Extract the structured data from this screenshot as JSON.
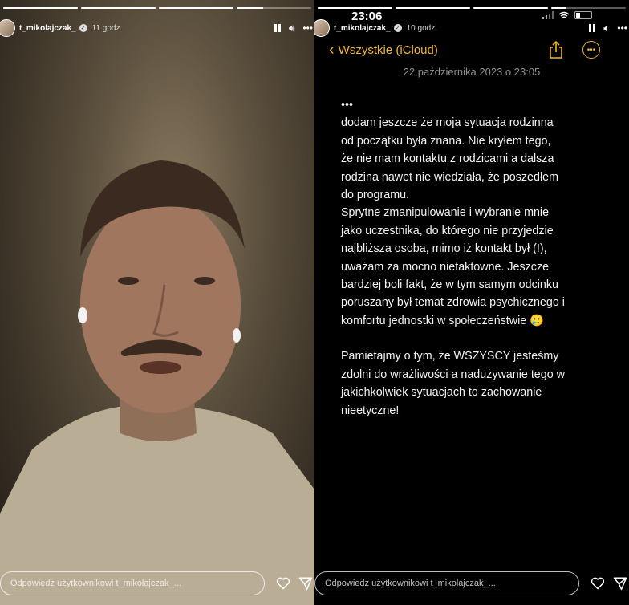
{
  "left_story": {
    "progress": [
      1,
      1,
      1,
      0.35
    ],
    "username": "t_mikolajczak_",
    "time": "11 godz.",
    "reply_placeholder": "Odpowiedz użytkownikowi t_mikolajczak_..."
  },
  "right_story": {
    "progress": [
      1,
      1,
      1,
      0.2
    ],
    "username": "t_mikolajczak_",
    "time": "10 godz.",
    "reply_placeholder": "Odpowiedz użytkownikowi t_mikolajczak_...",
    "ios_time": "23:06",
    "notes": {
      "back_label": "Wszystkie (iCloud)",
      "date": "22 października 2023 o 23:05",
      "ellipsis": "•••",
      "paragraph1": [
        "dodam jeszcze że moja sytuacja rodzinna",
        "od początku była znana. Nie kryłem tego,",
        "że nie mam kontaktu z rodzicami a dalsza",
        "rodzina nawet nie wiedziała, że poszedłem",
        "do programu.",
        "Sprytne zmanipulowanie i wybranie mnie",
        "jako uczestnika, do którego nie przyjedzie",
        "najbliższa osoba, mimo iż kontakt był (!),",
        "uważam za mocno nietaktowne. Jeszcze",
        "bardziej boli fakt, że w tym samym odcinku",
        "poruszany był temat zdrowia psychicznego i",
        "komfortu jednostki w społeczeństwie 🥲"
      ],
      "paragraph2": [
        "Pamietajmy o tym, że WSZYSCY jesteśmy",
        "zdolni do wrażliwości a nadużywanie tego w",
        "jakichkolwiek sytuacjach to zachowanie",
        "nieetyczne!"
      ]
    }
  },
  "colors": {
    "accent": "#f1b52d",
    "date_gray": "#8e8e93"
  },
  "icons": [
    "pause-icon",
    "volume-icon",
    "more-horizontal-icon",
    "verified-icon",
    "heart-icon",
    "send-icon",
    "share-icon",
    "more-circle-icon",
    "chevron-left-icon",
    "wifi-icon",
    "signal-icon",
    "battery-icon"
  ]
}
